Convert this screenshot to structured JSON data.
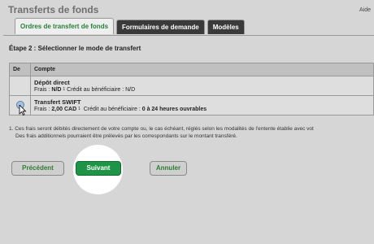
{
  "header": {
    "title": "Transferts de fonds",
    "help_label": "Aide"
  },
  "tabs": [
    {
      "label": "Ordres de transfert de fonds",
      "active": true
    },
    {
      "label": "Formulaires de demande",
      "active": false
    },
    {
      "label": "Modèles",
      "active": false
    }
  ],
  "step_title": "Étape 2 : Sélectionner le mode de transfert",
  "table": {
    "col_select": "De",
    "col_account": "Compte",
    "rows": [
      {
        "name": "Dépôt direct",
        "fees_label": "Frais : ",
        "fees_value": "N/D",
        "footnote": "1",
        "credit_text": "Crédit au bénéficiaire : N/D",
        "selected": false
      },
      {
        "name": "Transfert SWIFT",
        "fees_label": "Frais : ",
        "fees_value": "2,00 CAD",
        "footnote": "1",
        "credit_label": "Crédit au bénéficiaire : ",
        "credit_value": "0 à 24 heures ouvrables",
        "selected": true
      }
    ]
  },
  "note": {
    "line1": "1. Ces frais seront débités directement de votre compte ou, le cas échéant, réglés selon les modalités de l'entente établie avec vot",
    "line2": "Des frais additionnels pourraient être prélevés par les correspondants sur le montant transféré."
  },
  "buttons": {
    "previous": "Précédent",
    "next": "Suivant",
    "cancel": "Annuler"
  },
  "colors": {
    "accent_green": "#1f9446",
    "tab_active_text": "#27803a"
  }
}
